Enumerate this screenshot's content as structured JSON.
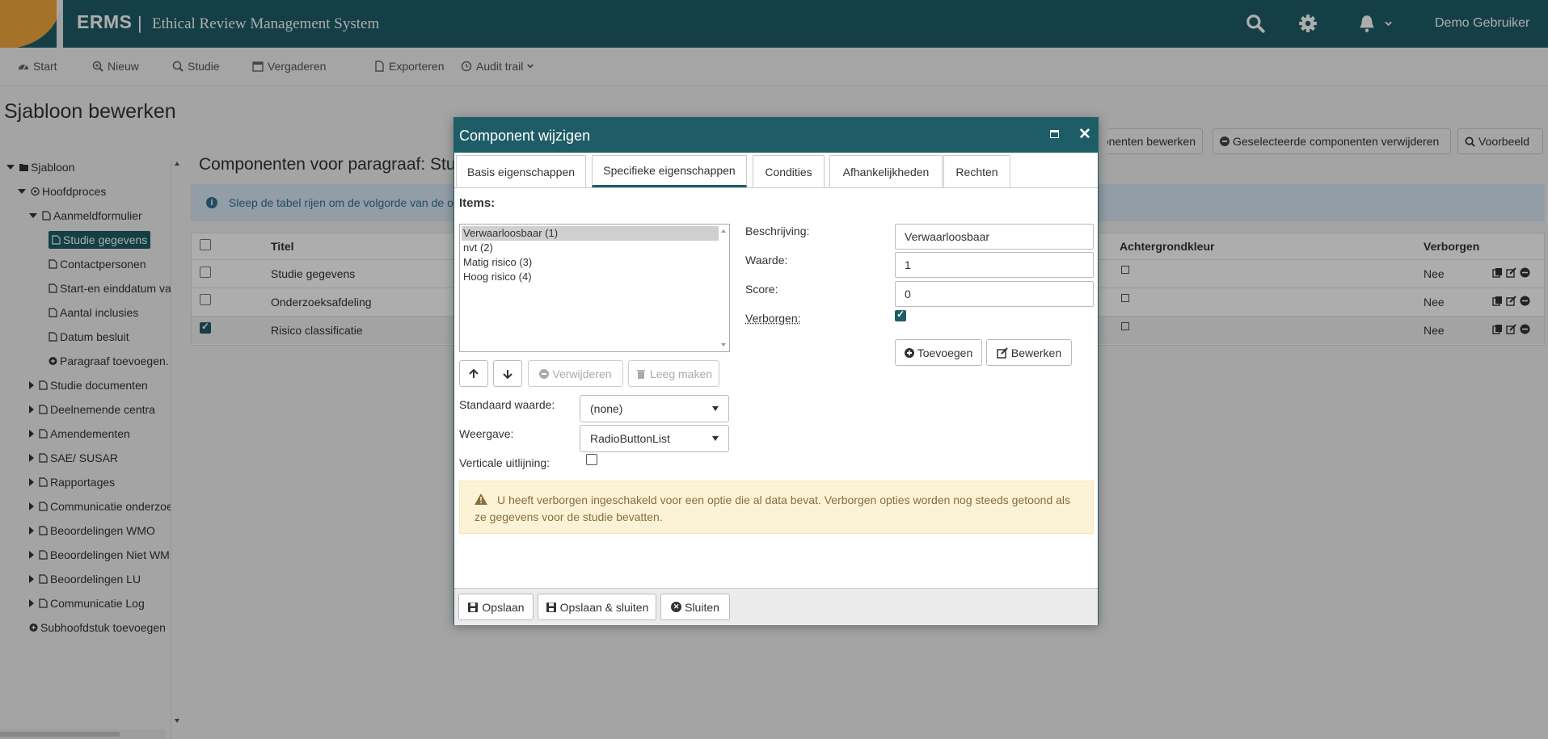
{
  "header": {
    "brand": "ERMS",
    "separator": "|",
    "subtitle": "Ethical Review Management System",
    "user": "Demo Gebruiker",
    "icons": [
      "search-icon",
      "gear-icon",
      "bell-icon",
      "chevron-down-icon"
    ]
  },
  "toolbar": {
    "items": [
      {
        "label": "Start",
        "icon": "dashboard-icon"
      },
      {
        "label": "Nieuw",
        "icon": "search-plus-icon"
      },
      {
        "label": "Studie",
        "icon": "search-icon"
      },
      {
        "label": "Vergaderen",
        "icon": "calendar-icon"
      },
      {
        "label": "Exporteren",
        "icon": "file-icon"
      },
      {
        "label": "Audit trail",
        "icon": "history-icon"
      }
    ]
  },
  "page": {
    "title": "Sjabloon bewerken"
  },
  "tree": {
    "items": [
      {
        "label": "Sjabloon",
        "level": 0,
        "state": "expanded",
        "icon": "folder-icon"
      },
      {
        "label": "Hoofdproces",
        "level": 1,
        "state": "expanded",
        "icon": "process-icon"
      },
      {
        "label": "Aanmeldformulier",
        "level": 2,
        "state": "expanded",
        "icon": "form-icon"
      },
      {
        "label": "Studie gegevens",
        "level": 3,
        "state": "leaf",
        "icon": "file-icon",
        "selected": true
      },
      {
        "label": "Contactpersonen",
        "level": 3,
        "state": "leaf",
        "icon": "file-icon"
      },
      {
        "label": "Start-en einddatum va",
        "level": 3,
        "state": "leaf",
        "icon": "file-icon"
      },
      {
        "label": "Aantal inclusies",
        "level": 3,
        "state": "leaf",
        "icon": "file-icon"
      },
      {
        "label": "Datum besluit",
        "level": 3,
        "state": "leaf",
        "icon": "file-icon"
      },
      {
        "label": "Paragraaf toevoegen.",
        "level": 3,
        "state": "leaf",
        "icon": "plus-circle-icon"
      },
      {
        "label": "Studie documenten",
        "level": 2,
        "state": "collapsed",
        "icon": "form-icon"
      },
      {
        "label": "Deelnemende centra",
        "level": 2,
        "state": "collapsed",
        "icon": "form-icon"
      },
      {
        "label": "Amendementen",
        "level": 2,
        "state": "collapsed",
        "icon": "form-icon"
      },
      {
        "label": "SAE/ SUSAR",
        "level": 2,
        "state": "collapsed",
        "icon": "form-icon"
      },
      {
        "label": "Rapportages",
        "level": 2,
        "state": "collapsed",
        "icon": "form-icon"
      },
      {
        "label": "Communicatie onderzoe",
        "level": 2,
        "state": "collapsed",
        "icon": "form-icon"
      },
      {
        "label": "Beoordelingen WMO",
        "level": 2,
        "state": "collapsed",
        "icon": "form-icon"
      },
      {
        "label": "Beoordelingen Niet WM",
        "level": 2,
        "state": "collapsed",
        "icon": "form-icon"
      },
      {
        "label": "Beoordelingen LU",
        "level": 2,
        "state": "collapsed",
        "icon": "form-icon"
      },
      {
        "label": "Communicatie Log",
        "level": 2,
        "state": "collapsed",
        "icon": "form-icon"
      },
      {
        "label": "Subhoofdstuk toevoegen",
        "level": 2,
        "state": "leaf",
        "icon": "plus-circle-icon"
      }
    ]
  },
  "content": {
    "title": "Componenten voor paragraaf: Stud",
    "info": "Sleep de tabel rijen om de volgorde van de onc",
    "top_buttons": [
      "ponenten bewerken",
      "Geselecteerde componenten verwijderen",
      "Voorbeeld"
    ],
    "table": {
      "headers": [
        "Titel",
        "Achtergrondkleur",
        "Verborgen"
      ],
      "rows": [
        {
          "title": "Studie gegevens",
          "hidden": "Nee",
          "checked": false
        },
        {
          "title": "Onderzoeksafdeling",
          "hidden": "Nee",
          "checked": false
        },
        {
          "title": "Risico classificatie",
          "hidden": "Nee",
          "checked": true
        }
      ]
    }
  },
  "dialog": {
    "title": "Component wijzigen",
    "tabs": [
      "Basis eigenschappen",
      "Specifieke eigenschappen",
      "Condities",
      "Afhankelijkheden",
      "Rechten"
    ],
    "active_tab": "Specifieke eigenschappen",
    "items_label": "Items:",
    "items": [
      "Verwaarloosbaar (1)",
      "nvt (2)",
      "Matig risico (3)",
      "Hoog risico (4)"
    ],
    "selected_item": "Verwaarloosbaar (1)",
    "list_buttons": {
      "delete": "Verwijderen",
      "clear": "Leeg maken"
    },
    "standaard_label": "Standaard waarde:",
    "standaard_value": "(none)",
    "weergave_label": "Weergave:",
    "weergave_value": "RadioButtonList",
    "verticale_label": "Verticale uitlijning:",
    "verticale_checked": false,
    "beschrijving_label": "Beschrijving:",
    "beschrijving_value": "Verwaarloosbaar",
    "waarde_label": "Waarde:",
    "waarde_value": "1",
    "score_label": "Score:",
    "score_value": "0",
    "verborgen_label": "Verborgen:",
    "verborgen_checked": true,
    "add_button": "Toevoegen",
    "edit_button": "Bewerken",
    "warning": "U heeft verborgen ingeschakeld voor een optie die al data bevat. Verborgen opties worden nog steeds getoond als ze gegevens voor de studie bevatten.",
    "footer": {
      "save": "Opslaan",
      "save_close": "Opslaan & sluiten",
      "close": "Sluiten"
    }
  },
  "colors": {
    "primary": "#1e5d68",
    "accent": "#f2a93b",
    "warning_bg": "#fcf3d6",
    "warning_text": "#8a6d3b",
    "info_bg": "#d9e8f5"
  }
}
